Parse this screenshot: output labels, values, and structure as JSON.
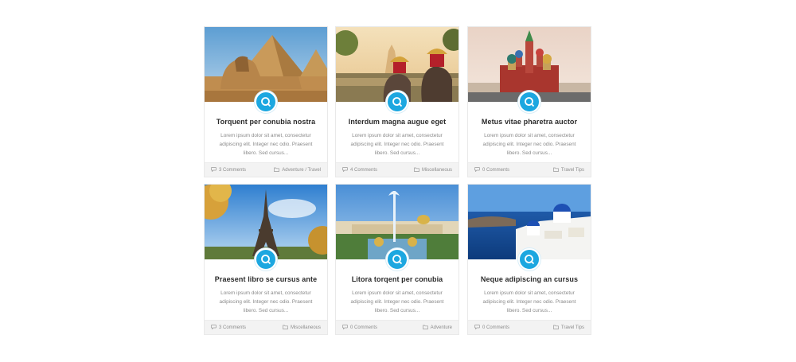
{
  "excerpt": "Lorem ipsum dolor sit amet, consectetur adipiscing elit. Integer nec odio. Praesent libero. Sed cursus...",
  "accent_color": "#1ca7e0",
  "cards": [
    {
      "title": "Torquent per conubia nostra",
      "comments": "3 Comments",
      "category": "Adventure / Travel",
      "image": "pyramids-sphinx"
    },
    {
      "title": "Interdum magna augue eget",
      "comments": "4 Comments",
      "category": "Miscellaneous",
      "image": "elephants-temple"
    },
    {
      "title": "Metus vitae pharetra auctor",
      "comments": "0 Comments",
      "category": "Travel Tips",
      "image": "saint-basils-cathedral"
    },
    {
      "title": "Praesent libro se cursus ante",
      "comments": "3 Comments",
      "category": "Miscellaneous",
      "image": "eiffel-tower"
    },
    {
      "title": "Litora torqent per conubia",
      "comments": "0 Comments",
      "category": "Adventure",
      "image": "peterhof-fountains"
    },
    {
      "title": "Neque adipiscing an cursus",
      "comments": "0 Comments",
      "category": "Travel Tips",
      "image": "santorini"
    }
  ]
}
